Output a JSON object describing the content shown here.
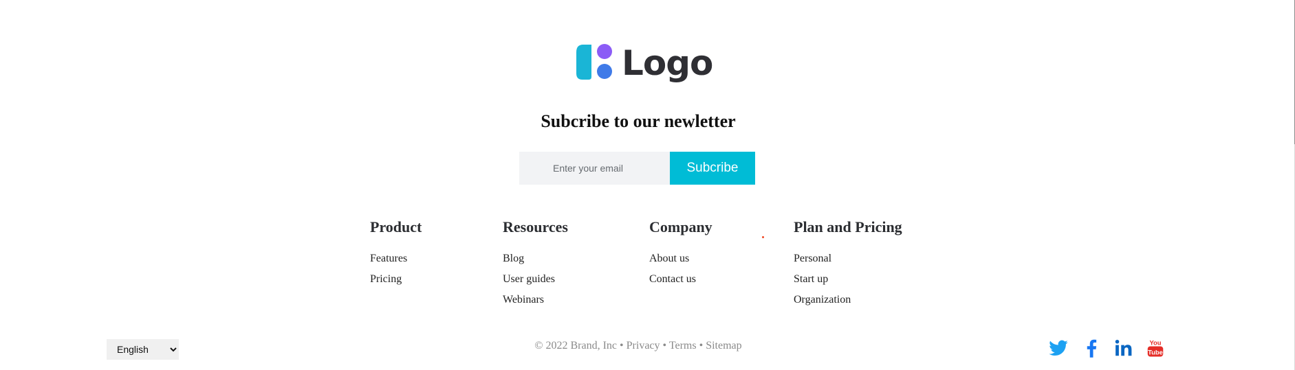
{
  "logo": {
    "text": "Logo"
  },
  "newsletter": {
    "title": "Subcribe to our newletter",
    "input_placeholder": "Enter your email",
    "button_label": "Subcribe"
  },
  "columns": [
    {
      "heading": "Product",
      "links": [
        "Features",
        "Pricing"
      ]
    },
    {
      "heading": "Resources",
      "links": [
        "Blog",
        "User guides",
        "Webinars"
      ]
    },
    {
      "heading": "Company",
      "links": [
        "About us",
        "Contact us"
      ]
    },
    {
      "heading": "Plan and Pricing",
      "links": [
        "Personal",
        "Start up",
        "Organization"
      ]
    }
  ],
  "bottom": {
    "language": "English",
    "copyright": "© 2022 Brand, Inc",
    "separator": " • ",
    "links": [
      "Privacy",
      "Terms",
      "Sitemap"
    ],
    "social": [
      {
        "icon": "twitter-icon",
        "color": "#1da1f2"
      },
      {
        "icon": "facebook-icon",
        "color": "#1877f2"
      },
      {
        "icon": "linkedin-icon",
        "color": "#0a66c2"
      },
      {
        "icon": "youtube-icon",
        "color": "#e52d27",
        "text": "You Tube"
      }
    ]
  },
  "colors": {
    "accent": "#00bcd6",
    "logo_cyan": "#1ab5d6",
    "logo_purple": "#8b5cf6",
    "logo_blue": "#3f7ae8"
  }
}
